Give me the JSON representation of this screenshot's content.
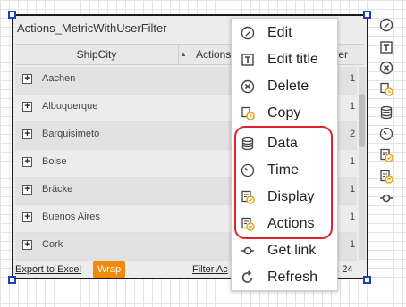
{
  "widget": {
    "title": "Actions_MetricWithUserFilter",
    "columns": {
      "city": "ShipCity",
      "sort_indicator": "▲",
      "actions": "Actions",
      "counter": "ter"
    },
    "rows": [
      {
        "city": "Aachen",
        "count": "1"
      },
      {
        "city": "Albuquerque",
        "count": "1"
      },
      {
        "city": "Barquisimeto",
        "count": "2"
      },
      {
        "city": "Boise",
        "count": "1"
      },
      {
        "city": "Bräcke",
        "count": "1"
      },
      {
        "city": "Buenos Aires",
        "count": "1"
      },
      {
        "city": "Cork",
        "count": "1"
      }
    ],
    "footer": {
      "export": "Export to Excel",
      "wrap": "Wrap",
      "filter": "Filter",
      "filter_trailing": " Ac",
      "count": "nt: 24"
    }
  },
  "context_menu": {
    "items": [
      {
        "label": "Edit",
        "icon": "pencil-circle-icon"
      },
      {
        "label": "Edit title",
        "icon": "text-box-icon"
      },
      {
        "label": "Delete",
        "icon": "delete-circle-icon"
      },
      {
        "label": "Copy",
        "icon": "copy-icon"
      },
      {
        "label": "Data",
        "icon": "database-icon"
      },
      {
        "label": "Time",
        "icon": "clock-icon"
      },
      {
        "label": "Display",
        "icon": "display-icon"
      },
      {
        "label": "Actions",
        "icon": "actions-icon"
      },
      {
        "label": "Get link",
        "icon": "link-icon"
      },
      {
        "label": "Refresh",
        "icon": "refresh-icon"
      }
    ],
    "highlight_color": "#e0202a"
  },
  "toolbar": {
    "icons": [
      "pencil-circle-icon",
      "text-box-icon",
      "delete-circle-icon",
      "copy-icon",
      "database-icon",
      "clock-icon",
      "display-icon",
      "actions-icon",
      "link-icon"
    ]
  },
  "colors": {
    "accent": "#f08a0a",
    "handle": "#1c3fbf",
    "icon_orange": "#e8a317"
  }
}
